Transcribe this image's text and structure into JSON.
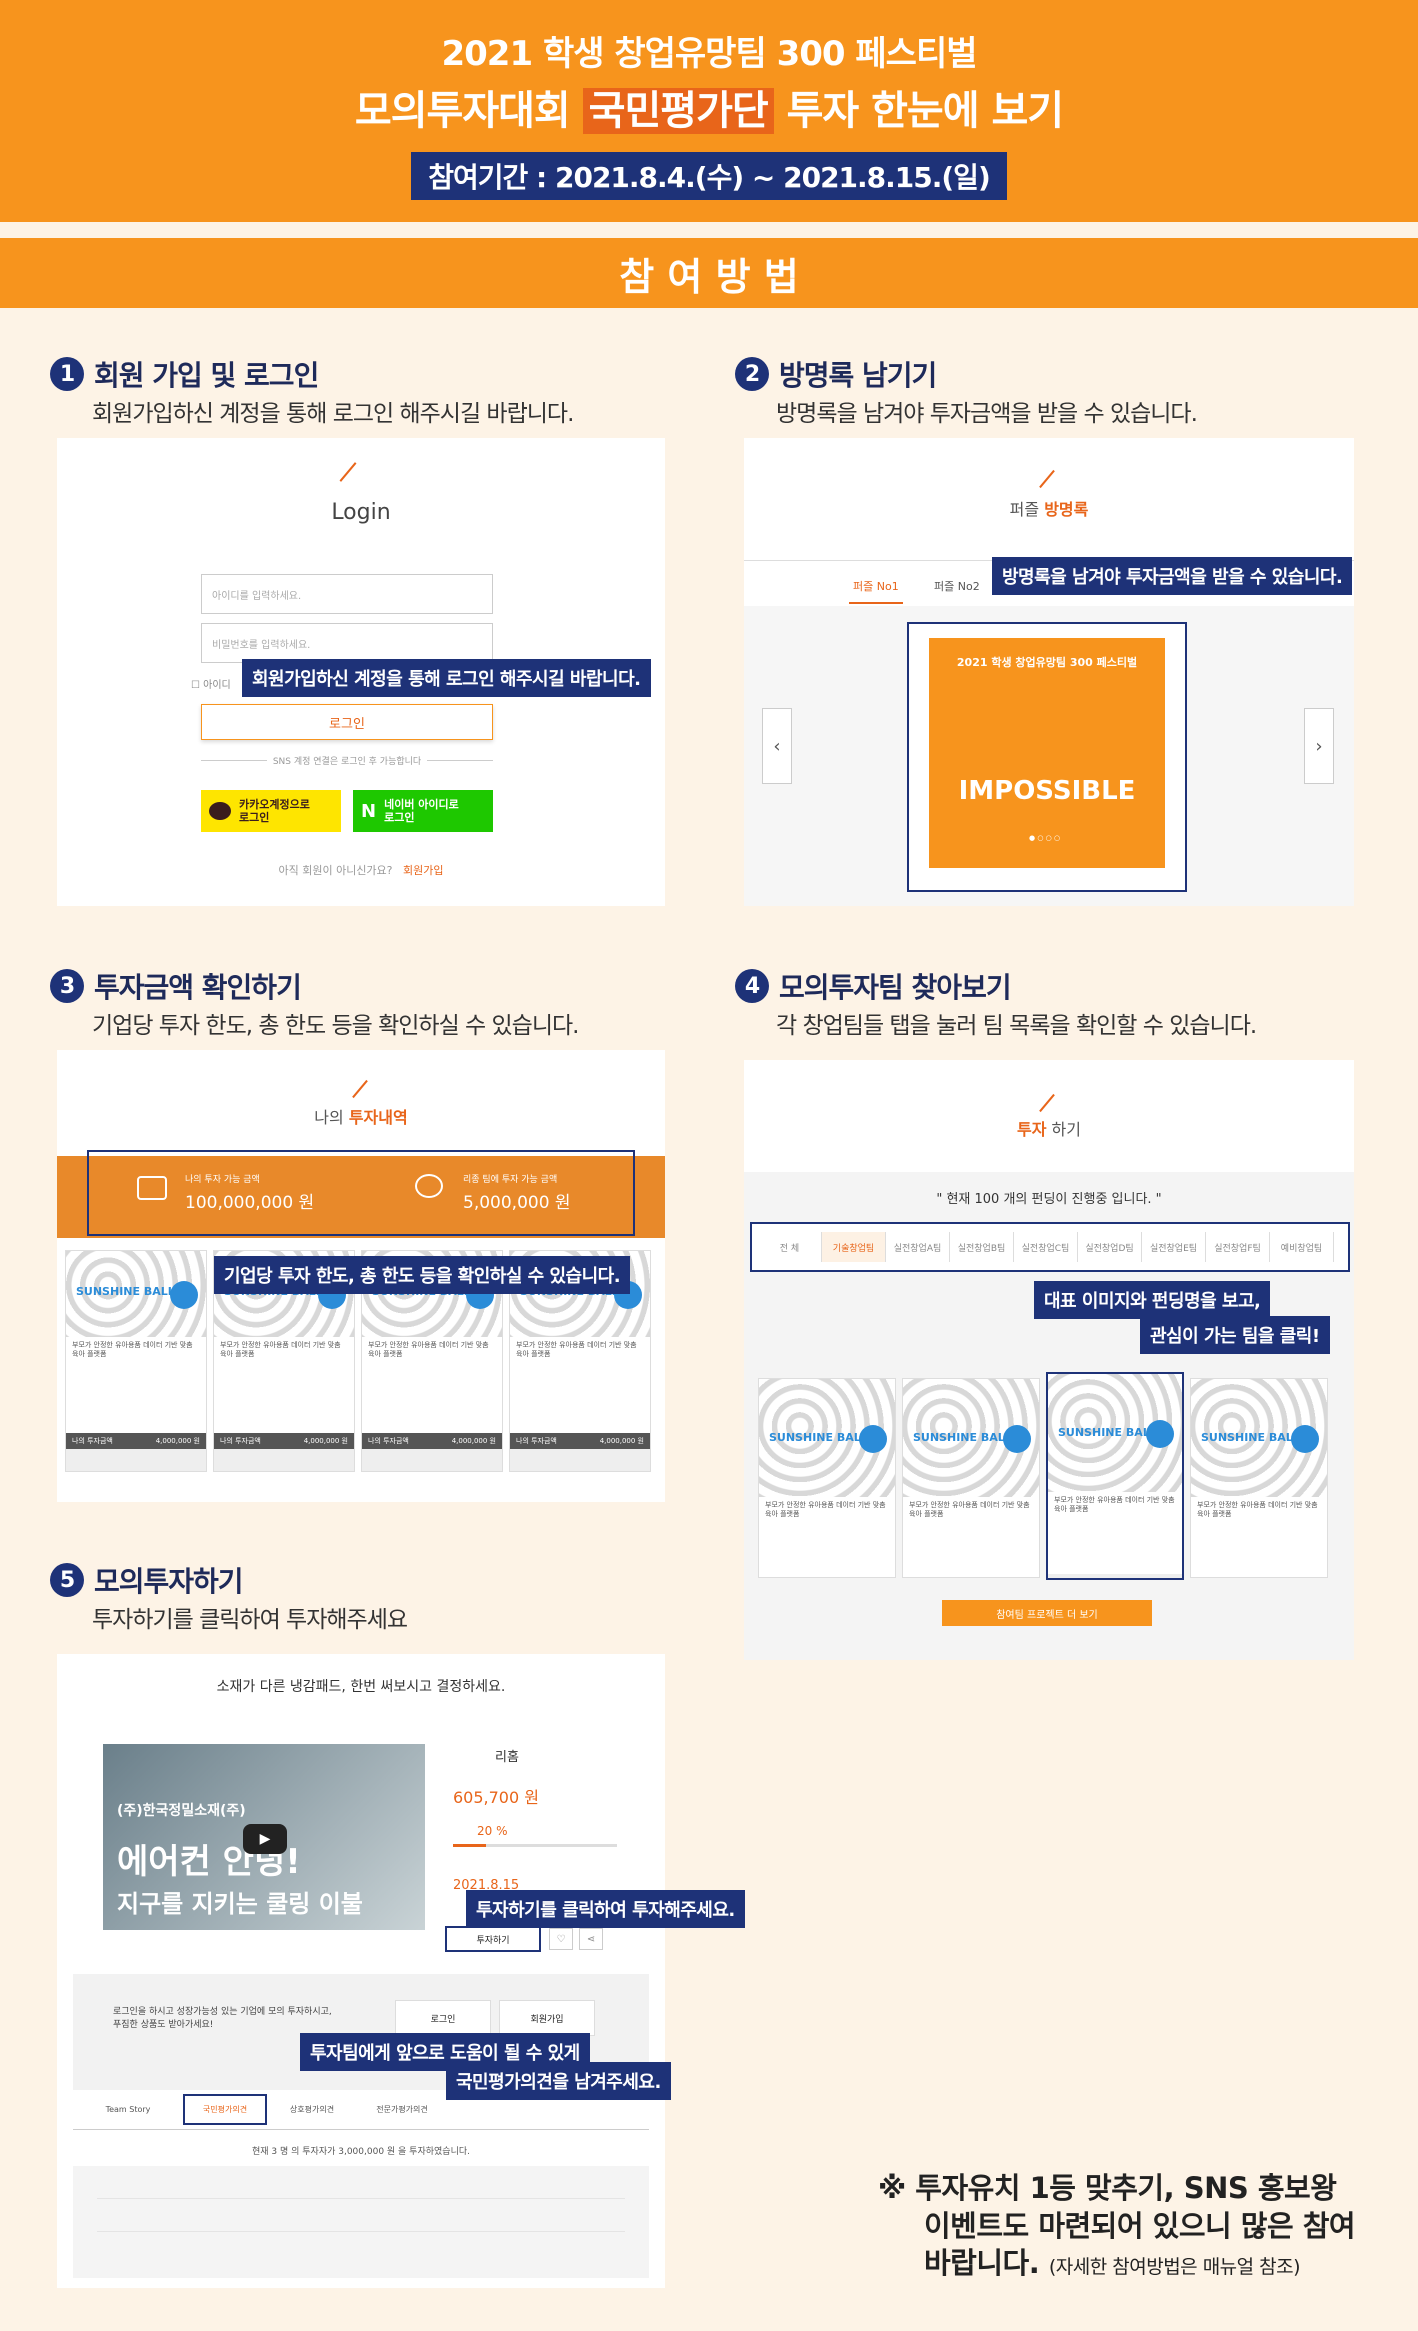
{
  "header": {
    "line1": "2021 학생 창업유망팀 300 페스티벌",
    "line2_pre": "모의투자대회",
    "line2_highlight": "국민평가단",
    "line2_post": "투자 한눈에 보기",
    "period": "참여기간 : 2021.8.4.(수) ~ 2021.8.15.(일)"
  },
  "method_title": "참 여 방 법",
  "steps": [
    {
      "num": "1",
      "title": "회원 가입 및 로그인",
      "desc": "회원가입하신 계정을 통해 로그인 해주시길 바랍니다."
    },
    {
      "num": "2",
      "title": "방명록 남기기",
      "desc": "방명록을 남겨야 투자금액을 받을 수 있습니다."
    },
    {
      "num": "3",
      "title": "투자금액 확인하기",
      "desc": "기업당 투자 한도, 총 한도 등을 확인하실 수 있습니다."
    },
    {
      "num": "4",
      "title": "모의투자팀 찾아보기",
      "desc": "각 창업팀들 탭을 눌러 팀 목록을 확인할 수 있습니다."
    },
    {
      "num": "5",
      "title": "모의투자하기",
      "desc": "투자하기를 클릭하여 투자해주세요"
    }
  ],
  "login": {
    "title": "Login",
    "id_placeholder": "아이디를 입력하세요.",
    "pw_placeholder": "비밀번호를 입력하세요.",
    "save_id": "아이디",
    "login_button": "로그인",
    "sns_note": "SNS 계정 연결은 로그인 후 가능합니다",
    "kakao": "카카오계정으로 로그인",
    "naver": "네이버 아이디로 로그인",
    "not_member": "아직 회원이 아니신가요?",
    "signup": "회원가입",
    "callout": "회원가입하신 계정을 통해 로그인 해주시길 바랍니다."
  },
  "guestbook": {
    "title_pre": "퍼즐",
    "title_hl": "방명록",
    "tab1": "퍼즐 No1",
    "tab2": "퍼즐 No2",
    "callout": "방명록을 남겨야 투자금액을 받을 수 있습니다.",
    "poster_title": "2021 학생 창업유망팀 300 페스티벌",
    "poster_word": "IMPOSSIBLE"
  },
  "invest_history": {
    "title_pre": "나의",
    "title_hl": "투자내역",
    "avail_label": "나의 투자 가능 금액",
    "avail_value": "100,000,000 원",
    "team_label": "리종 팀에 투자 가능 금액",
    "team_value": "5,000,000 원",
    "callout": "기업당 투자 한도, 총 한도 등을 확인하실 수 있습니다.",
    "brand": "SUNSHINE BALL",
    "item_text": "부모가 안정한 유아용품 데이터 기반 맞춤 육아 플랫폼",
    "my_invest": "나의 투자금액",
    "my_invest_val": "4,000,000 원"
  },
  "find_team": {
    "title_hl": "투자",
    "title_post": "하기",
    "notice": "\" 현재 100 개의 펀딩이 진행중 입니다. \"",
    "tabs": [
      "전 체",
      "기술창업팀",
      "실전창업A팀",
      "실전창업B팀",
      "실전창업C팀",
      "실전창업D팀",
      "실전창업E팀",
      "실전창업F팀",
      "예비창업팀"
    ],
    "callout1": "대표 이미지와 펀딩명을 보고,",
    "callout2": "관심이 가는 팀을 클릭!",
    "more": "참여팀 프로젝트 더 보기"
  },
  "invest": {
    "headline": "소재가 다른 냉감패드, 한번 써보시고 결정하세요.",
    "video_title": "에어컨 안녕!",
    "video_sub": "지구를 지키는 쿨링 이불",
    "company": "(주)한국정밀소재(주)",
    "team_name": "리홈",
    "amount": "605,700 원",
    "rate": "20 %",
    "date": "2021.8.15",
    "invest_button": "투자하기",
    "callout": "투자하기를 클릭하여 투자해주세요.",
    "login_note": "로그인을 하시고 성장가능성 있는 기업에 모의 투자하시고, 푸짐한 상품도 받아가세요!",
    "login_btn": "로그인",
    "signup_btn": "회원가입",
    "callout2a": "투자팀에게 앞으로 도움이 될 수 있게",
    "callout2b": "국민평가의견을 남겨주세요.",
    "tabs": [
      "Team Story",
      "국민평가의견",
      "상호평가의견",
      "전문가평가의견"
    ],
    "summary": "현재 3 명 의 투자자가 3,000,000 원 을 투자하였습니다."
  },
  "footer": {
    "line1": "※ 투자유치 1등 맞추기, SNS 홍보왕",
    "line2": "이벤트도 마련되어 있으니 많은 참여",
    "line3": "바랍니다.",
    "note": "(자세한 참여방법은 매뉴얼 참조)"
  }
}
